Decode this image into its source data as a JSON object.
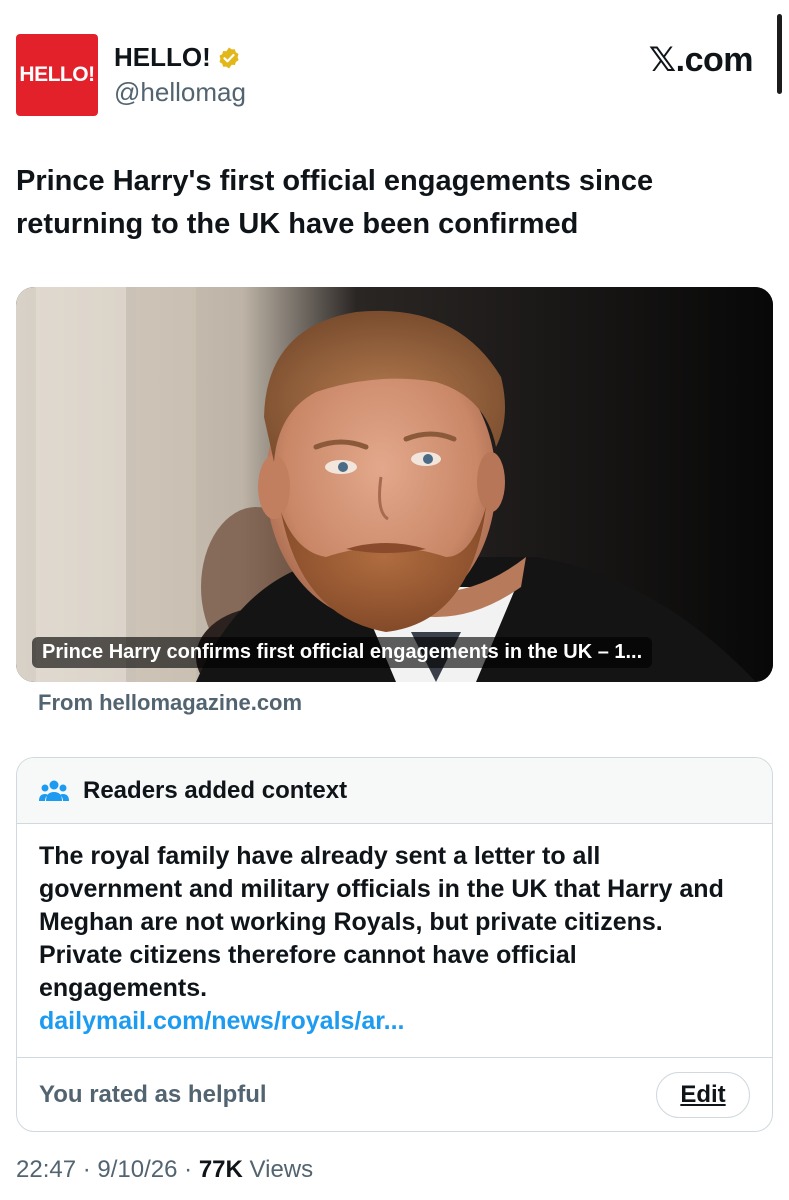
{
  "header": {
    "logo_text": "HELLO!",
    "author_name": "HELLO!",
    "handle": "@hellomag",
    "site_label": ".com",
    "site_x": "𝕏",
    "verified_color": "#e2b719"
  },
  "post": {
    "headline": "Prince Harry's first official engagements since returning to the UK have been confirmed",
    "link_card": {
      "caption": "Prince Harry confirms first official engagements in the UK – 1...",
      "source": "From hellomagazine.com"
    }
  },
  "context": {
    "title": "Readers added context",
    "body": "The royal family have already sent a letter to all government and military officials in the UK that Harry and Meghan are not working Royals, but private citizens. Private citizens therefore cannot have official engagements.",
    "link": "dailymail.com/news/royals/ar...",
    "rated_text": "You rated as helpful",
    "edit_label": "Edit"
  },
  "meta": {
    "time": "22:47",
    "date": "9/10/26",
    "views_count": "77K",
    "views_label": "Views"
  },
  "colors": {
    "accent_link": "#1d9bf0",
    "logo_red": "#e3212b",
    "muted_text": "#536471"
  }
}
